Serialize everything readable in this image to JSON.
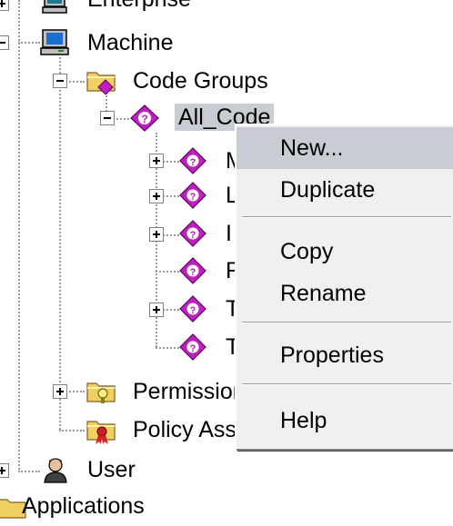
{
  "tree": {
    "enterprise_label": "Enterprise",
    "machine_label": "Machine",
    "code_groups_label": "Code Groups",
    "all_code_label": "All_Code",
    "child_initials": [
      "M",
      "L",
      "I",
      "R",
      "T",
      "T"
    ],
    "permission_sets_label": "Permission Sets",
    "policy_assemblies_label": "Policy Assemblies",
    "user_label": "User",
    "applications_label": "Applications"
  },
  "context_menu": {
    "items": [
      {
        "label": "New..."
      },
      {
        "label": "Duplicate"
      },
      {
        "label": "Copy"
      },
      {
        "label": "Rename"
      },
      {
        "label": "Properties"
      },
      {
        "label": "Help"
      }
    ]
  },
  "icons": {
    "computer": "computer-icon",
    "folder": "folder-icon",
    "code_group": "code-group-icon",
    "user": "user-icon"
  },
  "colors": {
    "selection": "#c9cdd3",
    "code_group_purple": "#c020c0",
    "folder_yellow": "#f0d060",
    "menu_bg": "#f0f0f0"
  }
}
